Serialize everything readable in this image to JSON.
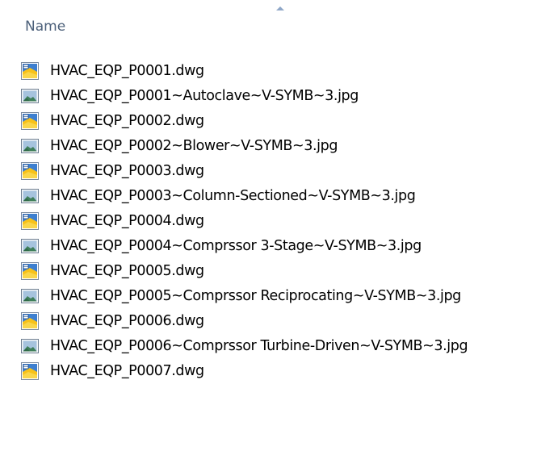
{
  "header": {
    "name_label": "Name"
  },
  "files": [
    {
      "name": "HVAC_EQP_P0001.dwg",
      "icon": "dwg-file-icon"
    },
    {
      "name": "HVAC_EQP_P0001~Autoclave~V-SYMB~3.jpg",
      "icon": "jpg-file-icon"
    },
    {
      "name": "HVAC_EQP_P0002.dwg",
      "icon": "dwg-file-icon"
    },
    {
      "name": "HVAC_EQP_P0002~Blower~V-SYMB~3.jpg",
      "icon": "jpg-file-icon"
    },
    {
      "name": "HVAC_EQP_P0003.dwg",
      "icon": "dwg-file-icon"
    },
    {
      "name": "HVAC_EQP_P0003~Column-Sectioned~V-SYMB~3.jpg",
      "icon": "jpg-file-icon"
    },
    {
      "name": "HVAC_EQP_P0004.dwg",
      "icon": "dwg-file-icon"
    },
    {
      "name": "HVAC_EQP_P0004~Comprssor 3-Stage~V-SYMB~3.jpg",
      "icon": "jpg-file-icon"
    },
    {
      "name": "HVAC_EQP_P0005.dwg",
      "icon": "dwg-file-icon"
    },
    {
      "name": "HVAC_EQP_P0005~Comprssor Reciprocating~V-SYMB~3.jpg",
      "icon": "jpg-file-icon"
    },
    {
      "name": "HVAC_EQP_P0006.dwg",
      "icon": "dwg-file-icon"
    },
    {
      "name": "HVAC_EQP_P0006~Comprssor Turbine-Driven~V-SYMB~3.jpg",
      "icon": "jpg-file-icon"
    },
    {
      "name": "HVAC_EQP_P0007.dwg",
      "icon": "dwg-file-icon"
    }
  ],
  "colors": {
    "header_text": "#4c607a",
    "sort_arrow": "#8fa7c8"
  }
}
